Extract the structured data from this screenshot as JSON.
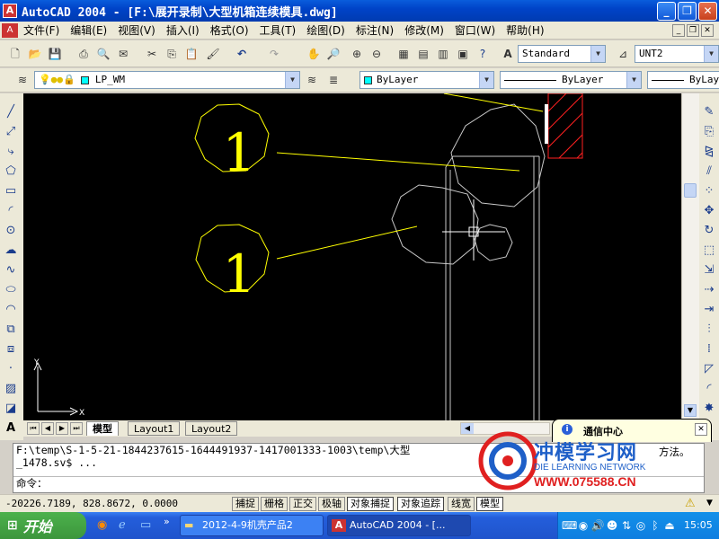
{
  "window": {
    "app_icon": "autocad-icon",
    "title": "AutoCAD 2004 - [F:\\展开录制\\大型机箱连续模具.dwg]",
    "minimize": "_",
    "restore": "❐",
    "close": "✕"
  },
  "menu": {
    "items": [
      "文件(F)",
      "编辑(E)",
      "视图(V)",
      "插入(I)",
      "格式(O)",
      "工具(T)",
      "绘图(D)",
      "标注(N)",
      "修改(M)",
      "窗口(W)",
      "帮助(H)"
    ]
  },
  "toolbar": {
    "text_style": "Standard",
    "dim_style": "UNT2",
    "layer_name": "LP_WM",
    "color": "ByLayer",
    "linetype": "ByLayer",
    "lineweight": "ByLay"
  },
  "drawing": {
    "balloon_labels": [
      "1",
      "1"
    ],
    "ucs_y": "Y",
    "ucs_x": "X"
  },
  "layout_tabs": [
    "模型",
    "Layout1",
    "Layout2"
  ],
  "command": {
    "lines": [
      "F:\\temp\\S-1-5-21-1844237615-1644491937-1417001333-1003\\temp\\大型",
      "_1478.sv$ ...",
      "命令："
    ],
    "tail_text": "方法。"
  },
  "status": {
    "coordinates": "-20226.7189, 828.8672, 0.0000",
    "toggles": [
      "捕捉",
      "栅格",
      "正交",
      "极轴",
      "对象捕捉",
      "对象追踪",
      "线宽",
      "模型"
    ],
    "active": [
      "对象捕捉",
      "对象追踪",
      "模型"
    ]
  },
  "notification": {
    "title": "通信中心",
    "close": "✕"
  },
  "watermark": {
    "brand": "冲模学习网",
    "subtitle": "DIE LEARNING NETWORK",
    "url": "WWW.075588.CN"
  },
  "taskbar": {
    "start_label": "开始",
    "tasks": [
      "2012-4-9机壳产品2",
      "AutoCAD 2004 - [..."
    ],
    "clock": "15:05"
  },
  "colors": {
    "canvas": "#000000",
    "drawing_yellow": "#ffff00",
    "geometry_gray": "#c8c8c8",
    "hatch_red": "#ff2020",
    "title_blue": "#0a5ddc",
    "accent_brand": "#1e5fc8"
  }
}
